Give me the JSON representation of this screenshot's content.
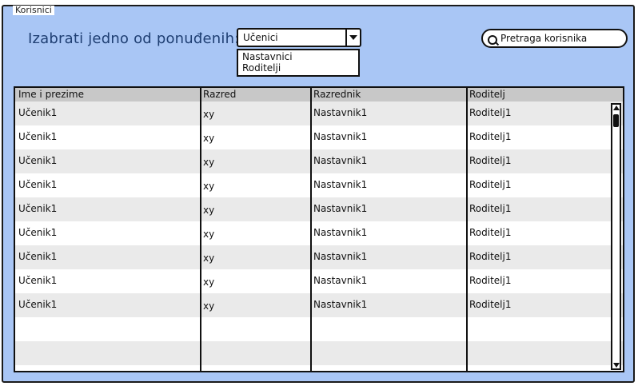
{
  "frame": {
    "title": "Korisnici"
  },
  "chooser": {
    "label": "Izabrati jedno od ponuđenih:",
    "selected": "Učenici",
    "options": [
      "Nastavnici",
      "Roditelji"
    ]
  },
  "search": {
    "placeholder": "Pretraga korisnika"
  },
  "table": {
    "headers": [
      "Ime i prezime",
      "Razred",
      "Razrednik",
      "Roditelj"
    ],
    "rows": [
      [
        "Učenik1",
        "xy",
        "Nastavnik1",
        "Roditelj1"
      ],
      [
        "Učenik1",
        "xy",
        "Nastavnik1",
        "Roditelj1"
      ],
      [
        "Učenik1",
        "xy",
        "Nastavnik1",
        "Roditelj1"
      ],
      [
        "Učenik1",
        "xy",
        "Nastavnik1",
        "Roditelj1"
      ],
      [
        "Učenik1",
        "xy",
        "Nastavnik1",
        "Roditelj1"
      ],
      [
        "Učenik1",
        "xy",
        "Nastavnik1",
        "Roditelj1"
      ],
      [
        "Učenik1",
        "xy",
        "Nastavnik1",
        "Roditelj1"
      ],
      [
        "Učenik1",
        "xy",
        "Nastavnik1",
        "Roditelj1"
      ],
      [
        "Učenik1",
        "xy",
        "Nastavnik1",
        "Roditelj1"
      ],
      [
        "",
        "",
        "",
        ""
      ],
      [
        "",
        "",
        "",
        ""
      ]
    ]
  },
  "colors": {
    "panel_background": "#a9c6f5",
    "label_text": "#1f3f73",
    "header_background": "#c8c8c8",
    "alt_row_background": "#eaeaea"
  },
  "icons": {
    "search": "search-icon",
    "dropdown": "chevron-down-icon",
    "scroll_up": "arrow-up-icon",
    "scroll_down": "arrow-down-icon"
  }
}
